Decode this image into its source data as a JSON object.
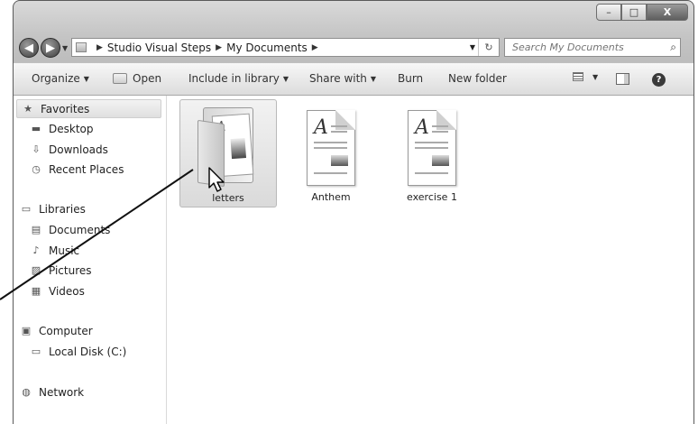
{
  "window": {
    "controls": {
      "minimize": "–",
      "maximize": "□",
      "close": "X"
    }
  },
  "nav": {
    "back": "◀",
    "forward": "▶",
    "breadcrumb": [
      "Studio Visual Steps",
      "My Documents"
    ],
    "search_placeholder": "Search My Documents"
  },
  "toolbar": {
    "organize": "Organize",
    "open": "Open",
    "include_in_library": "Include in library",
    "share_with": "Share with",
    "burn": "Burn",
    "new_folder": "New folder",
    "help": "?"
  },
  "sidebar": {
    "favorites": {
      "label": "Favorites",
      "items": [
        "Desktop",
        "Downloads",
        "Recent Places"
      ]
    },
    "libraries": {
      "label": "Libraries",
      "items": [
        "Documents",
        "Music",
        "Pictures",
        "Videos"
      ]
    },
    "computer": {
      "label": "Computer",
      "items": [
        "Local Disk (C:)"
      ]
    },
    "network": {
      "label": "Network"
    }
  },
  "files": [
    {
      "name": "letters",
      "type": "folder",
      "selected": true
    },
    {
      "name": "Anthem",
      "type": "document",
      "selected": false
    },
    {
      "name": "exercise 1",
      "type": "document",
      "selected": false
    }
  ],
  "colors": {
    "chrome_gray": "#c4c4c4",
    "selection": "#dadada",
    "window_border": "#5a5a5a"
  }
}
